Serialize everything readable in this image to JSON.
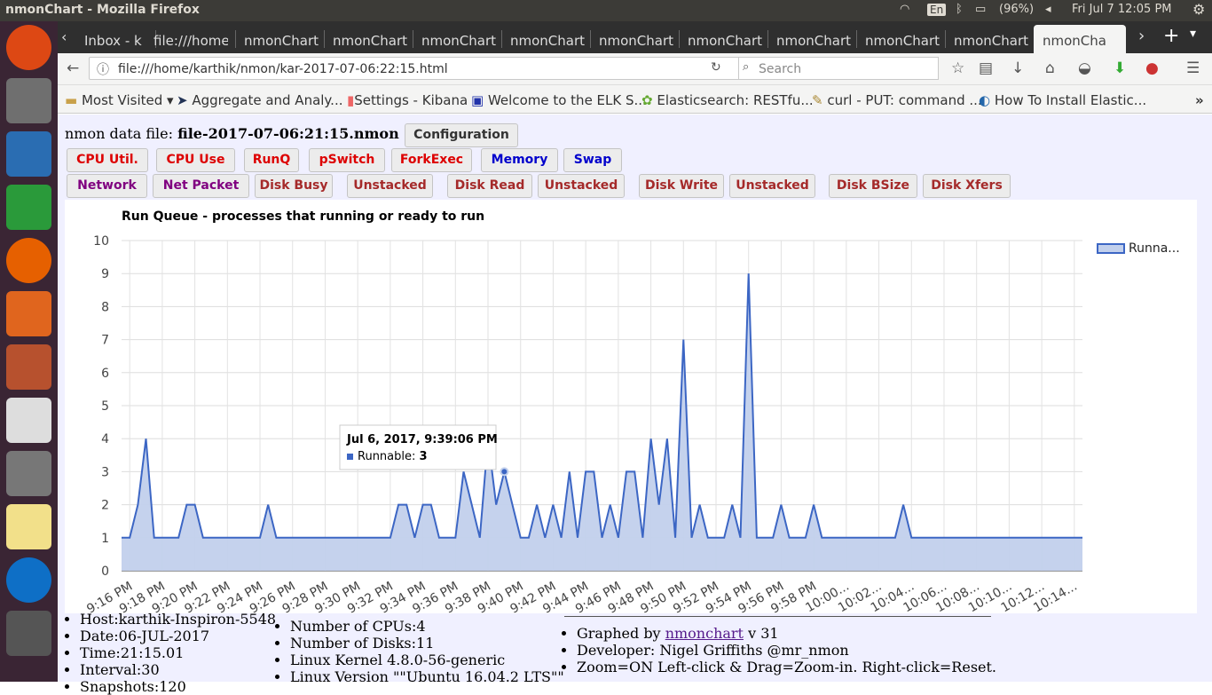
{
  "os": {
    "window_title": "nmonChart - Mozilla Firefox",
    "keyboard": "En",
    "battery": "(96%)",
    "clock": "Fri Jul  7 12:05 PM"
  },
  "tabs": [
    {
      "label": "Inbox - k"
    },
    {
      "label": "file:///home"
    },
    {
      "label": "nmonChart"
    },
    {
      "label": "nmonChart"
    },
    {
      "label": "nmonChart"
    },
    {
      "label": "nmonChart"
    },
    {
      "label": "nmonChart"
    },
    {
      "label": "nmonChart"
    },
    {
      "label": "nmonChart"
    },
    {
      "label": "nmonChart"
    },
    {
      "label": "nmonChart"
    },
    {
      "label": "nmonCha"
    }
  ],
  "nav": {
    "url": "file:///home/karthik/nmon/kar-2017-07-06:22:15.html",
    "search_placeholder": "Search"
  },
  "bookmarks": [
    {
      "label": "Most Visited ▾"
    },
    {
      "label": "Aggregate and Analy..."
    },
    {
      "label": "Settings - Kibana"
    },
    {
      "label": "Welcome to the ELK S..."
    },
    {
      "label": "Elasticsearch: RESTfu..."
    },
    {
      "label": "curl - PUT: command ..."
    },
    {
      "label": "How To Install Elastic..."
    }
  ],
  "page": {
    "file_prefix": "nmon data file: ",
    "file_name": "file-2017-07-06:21:15.nmon",
    "config_button": "Configuration",
    "buttons_row1": [
      {
        "label": "CPU Util.",
        "color": "#dd0000"
      },
      {
        "label": "CPU Use",
        "color": "#dd0000"
      },
      {
        "label": "RunQ",
        "color": "#dd0000"
      },
      {
        "label": "pSwitch",
        "color": "#dd0000"
      },
      {
        "label": "ForkExec",
        "color": "#dd0000"
      },
      {
        "label": "Memory",
        "color": "#0000cc"
      },
      {
        "label": "Swap",
        "color": "#0000cc"
      }
    ],
    "buttons_row2": [
      {
        "label": "Network",
        "color": "#800080"
      },
      {
        "label": "Net Packet",
        "color": "#800080"
      },
      {
        "label": "Disk Busy",
        "color": "#a52a2a"
      },
      {
        "label": "Unstacked",
        "color": "#a52a2a"
      },
      {
        "label": "Disk Read",
        "color": "#a52a2a"
      },
      {
        "label": "Unstacked",
        "color": "#a52a2a"
      },
      {
        "label": "Disk Write",
        "color": "#a52a2a"
      },
      {
        "label": "Unstacked",
        "color": "#a52a2a"
      },
      {
        "label": "Disk BSize",
        "color": "#a52a2a"
      },
      {
        "label": "Disk Xfers",
        "color": "#a52a2a"
      }
    ]
  },
  "chart_data": {
    "type": "area",
    "title": "Run Queue - processes that running or ready to run",
    "legend": "Runna...",
    "legend_position": "right",
    "ylim": [
      0,
      10
    ],
    "yticks": [
      "0",
      "1",
      "2",
      "3",
      "4",
      "5",
      "6",
      "7",
      "8",
      "9",
      "10"
    ],
    "xticks": [
      "9:16 PM",
      "9:18 PM",
      "9:20 PM",
      "9:22 PM",
      "9:24 PM",
      "9:26 PM",
      "9:28 PM",
      "9:30 PM",
      "9:32 PM",
      "9:34 PM",
      "9:36 PM",
      "9:38 PM",
      "9:40 PM",
      "9:42 PM",
      "9:44 PM",
      "9:46 PM",
      "9:48 PM",
      "9:50 PM",
      "9:52 PM",
      "9:54 PM",
      "9:56 PM",
      "9:58 PM",
      "10:00...",
      "10:02...",
      "10:04...",
      "10:06...",
      "10:08...",
      "10:10...",
      "10:12...",
      "10:14..."
    ],
    "x_start": "9:15:36 PM",
    "interval_seconds": 30,
    "values": [
      1,
      1,
      2,
      4,
      1,
      1,
      1,
      1,
      2,
      2,
      1,
      1,
      1,
      1,
      1,
      1,
      1,
      1,
      2,
      1,
      1,
      1,
      1,
      1,
      1,
      1,
      1,
      1,
      1,
      1,
      1,
      1,
      1,
      1,
      2,
      2,
      1,
      2,
      2,
      1,
      1,
      1,
      3,
      2,
      1,
      4,
      2,
      3,
      2,
      1,
      1,
      2,
      1,
      2,
      1,
      3,
      1,
      3,
      3,
      1,
      2,
      1,
      3,
      3,
      1,
      4,
      2,
      4,
      1,
      7,
      1,
      2,
      1,
      1,
      1,
      2,
      1,
      9,
      1,
      1,
      1,
      2,
      1,
      1,
      1,
      2,
      1,
      1,
      1,
      1,
      1,
      1,
      1,
      1,
      1,
      1,
      2,
      1,
      1,
      1,
      1,
      1,
      1,
      1,
      1,
      1,
      1,
      1,
      1,
      1,
      1,
      1,
      1,
      1,
      1,
      1,
      1,
      1,
      1
    ],
    "grid": true,
    "tooltip": {
      "title": "Jul 6, 2017, 9:39:06 PM",
      "series": "Runnable: ",
      "value": "3"
    }
  },
  "info": {
    "col1": [
      "Host:karthik-Inspiron-5548",
      "Date:06-JUL-2017",
      "Time:21:15.01",
      "Interval:30",
      "Snapshots:120"
    ],
    "col2": [
      "Number of CPUs:4",
      "Number of Disks:11",
      "Linux Kernel 4.8.0-56-generic",
      "Linux Version \"\"Ubuntu 16.04.2 LTS\"\""
    ],
    "col3_prefix": "Graphed by ",
    "col3_link": "nmonchart",
    "col3_suffix": " v 31",
    "col3": [
      "Developer: Nigel Griffiths @mr_nmon",
      "Zoom=ON Left-click & Drag=Zoom-in. Right-click=Reset."
    ]
  }
}
